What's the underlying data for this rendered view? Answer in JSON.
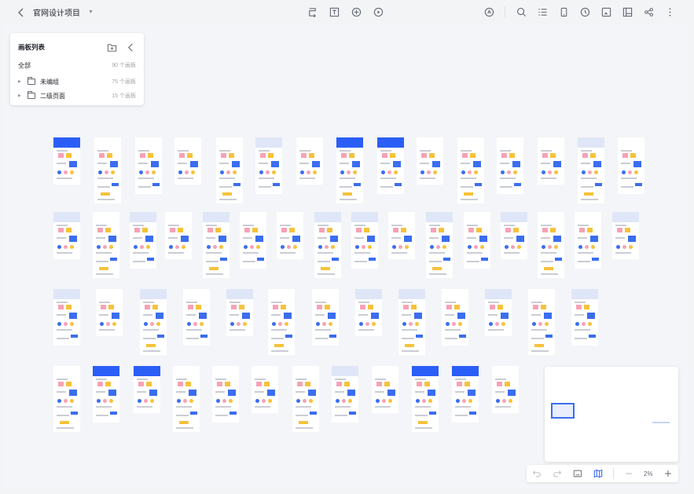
{
  "header": {
    "project_title": "官网设计项目"
  },
  "icons": {
    "left": [
      "back-icon",
      "chevron-down-icon"
    ],
    "center": [
      "connector-icon",
      "text-icon",
      "add-icon",
      "play-icon"
    ],
    "right": [
      "ai-icon",
      "search-icon",
      "list-icon",
      "device-icon",
      "history-icon",
      "image-icon",
      "layout-icon",
      "share-icon",
      "more-icon"
    ],
    "bottom": [
      "undo-icon",
      "redo-icon",
      "keyboard-icon",
      "map-icon",
      "zoom-out-icon",
      "zoom-in-icon"
    ]
  },
  "panel": {
    "title": "画板列表",
    "all": {
      "label": "全部",
      "count": "90 个画板"
    },
    "folders": [
      {
        "label": "未编组",
        "count": "75 个画板"
      },
      {
        "label": "二级页面",
        "count": "15 个画板"
      }
    ]
  },
  "toolbar": {
    "zoom_level": "2%"
  },
  "colors": {
    "accent": "#2b5ef7",
    "pink": "#f7a2b6",
    "yellow": "#f7c23a"
  }
}
